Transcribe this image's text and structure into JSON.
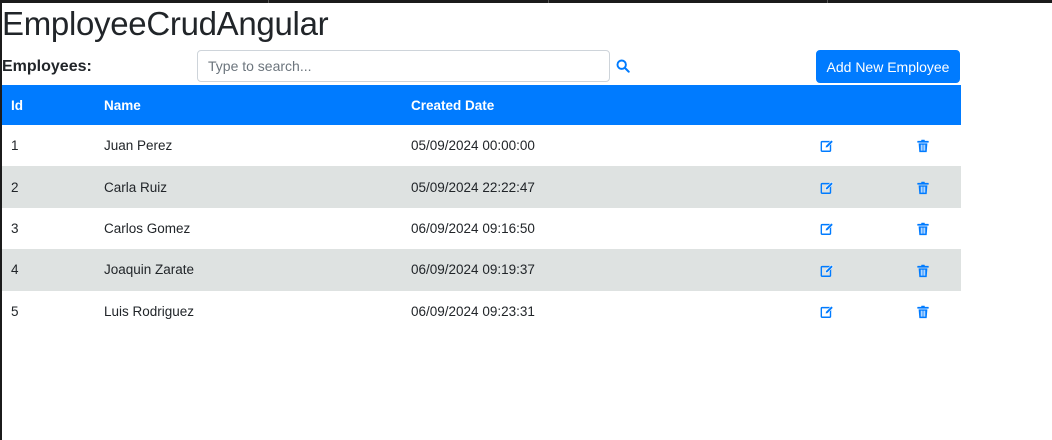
{
  "app": {
    "title": "EmployeeCrudAngular"
  },
  "toolbar": {
    "label": "Employees:",
    "search_placeholder": "Type to search...",
    "search_icon": "search-icon",
    "add_button_label": "Add New Employee"
  },
  "table": {
    "headers": {
      "id": "Id",
      "name": "Name",
      "created": "Created Date"
    },
    "rows": [
      {
        "id": "1",
        "name": "Juan Perez",
        "created": "05/09/2024 00:00:00"
      },
      {
        "id": "2",
        "name": "Carla Ruiz",
        "created": "05/09/2024 22:22:47"
      },
      {
        "id": "3",
        "name": "Carlos Gomez",
        "created": "06/09/2024 09:16:50"
      },
      {
        "id": "4",
        "name": "Joaquin Zarate",
        "created": "06/09/2024 09:19:37"
      },
      {
        "id": "5",
        "name": "Luis Rodriguez",
        "created": "06/09/2024 09:23:31"
      }
    ],
    "row_icons": {
      "edit": "edit-icon",
      "delete": "trash-icon"
    }
  },
  "colors": {
    "primary": "#007bff",
    "striped_row": "#dee2e1",
    "text": "#212529"
  }
}
